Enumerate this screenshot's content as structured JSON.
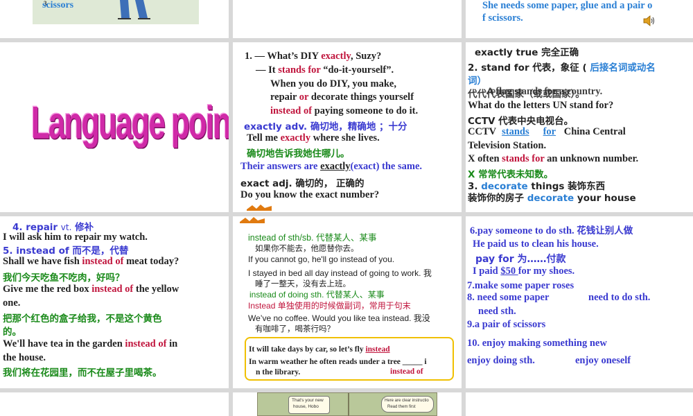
{
  "panel1": {
    "number": "3",
    "caption": "scissors"
  },
  "panel3": {
    "line1": "She needs some paper, glue and a pair o",
    "line2": "f scissors."
  },
  "panel4": {
    "title": "Language points"
  },
  "panel5": {
    "l1_a": "1. — What’s DIY ",
    "l1_b": "exactly",
    "l1_c": ", Suzy?",
    "l2_a": "— It ",
    "l2_b": "stands for",
    "l2_c": " “do-it-yourself”.",
    "l3": "When you do DIY, you make,",
    "l4_a": "repair ",
    "l4_b": "or",
    "l4_c": " decorate things yourself",
    "l5_a": "instead of",
    "l5_b": " paying someone to do it.",
    "l6": "exactly adv.  确切地，精确地  ；十分",
    "l7_a": "Tell me ",
    "l7_b": "exactly",
    "l7_c": " where she lives.",
    "l8": "确切地告诉我她住哪儿。",
    "l9_a": "Their answers are ",
    "l9_b": "exactly",
    "l9_c": "(exact) the same.",
    "l10": "exact  adj.   确切的，  正确的",
    "l11": "Do you know the exact number?"
  },
  "panel6": {
    "l1": "exactly true   完全正确",
    "l2_a": "2. stand for   代表，象征 (",
    "l2_b": " 后接名词或动名",
    "l3": "词）",
    "l4_overlap_a": "代代代表国家（或或国家）。",
    "l4_overlap_b": "A flag stands for a country.",
    "l5": "What do the letters UN stand for?",
    "l6": "CCTV 代表中央电视台。",
    "l7_a": "CCTV",
    "l7_b": "stands",
    "l7_c": "for",
    "l7_d": " China Central",
    "l8": "Television Station.",
    "l9_a": "X often ",
    "l9_b": "stands for",
    "l9_c": " an unknown number.",
    "l10": "X 常常代表未知数。",
    "l11_a": "3. ",
    "l11_b": "decorate",
    "l11_c": " things  装饰东西",
    "l12_a": "装饰你的房子  ",
    "l12_b": "decorate",
    "l12_c": " your house"
  },
  "panel7": {
    "l1_a": "4.   repair  ",
    "l1_b": "vt.",
    "l1_c": "    修补",
    "l2": "I will ask him to repair my watch.",
    "l3": "5.  instead of  而不是，代替",
    "l4_a": "Shall we have fish ",
    "l4_b": "instead of",
    "l4_c": " meat today?",
    "l5": "我们今天吃鱼不吃肉，好吗？",
    "l6_a": "Give me the red box ",
    "l6_b": "instead of",
    "l6_c": " the yellow",
    "l7": "one.",
    "l8": "把那个红色的盒子给我，不是这个黄色",
    "l9": "的。",
    "l10_a": "We'll have tea in the garden ",
    "l10_b": "instead of",
    "l10_c": " in",
    "l11": "the house.",
    "l12": "我们将在花园里，而不在屋子里喝茶。"
  },
  "panel8": {
    "l1": "instead of  sth/sb. 代替某人、某事",
    "l2": "如果你不能去，他愿替你去。",
    "l3": "If you cannot go, he'll go instead of you.",
    "l4": "I stayed in bed all day instead of going to work.  我",
    "l5": "睡了一整天，没有去上班。",
    "l6": "instead of  doing  sth. 代替某人、某事",
    "l7_a": "Instead",
    "l7_b": "  单独使用的时候做副词，常用于句末",
    "l8": "We’ve no coffee. Would you like tea instead.  我没",
    "l9": "有咖啡了，喝茶行吗？",
    "box_l1_a": "It will take days by car, so let’s fly ",
    "box_l1_b": "instead",
    "box_l2": "In warm weather he often reads under a tree _____ i",
    "box_l3": "n the library.",
    "box_answer2": "instead of"
  },
  "panel9": {
    "l1_a": "6.pay someone to do sth.    ",
    "l1_b": "花钱让别人做",
    "l2": "He paid us to clean his house.",
    "l3": "pay for   为……付款",
    "l4_a": "I paid ",
    "l4_b": "$50 ",
    "l4_c": "for my shoes.",
    "l5": "7.make some paper roses",
    "l6_a": "8. need some paper",
    "l6_b": "need to do sth.",
    "l7": "need sth.",
    "l8": "9.a pair of scissors",
    "l9": "10. enjoy making something new",
    "l10_a": "enjoy doing sth.",
    "l10_b": "enjoy oneself"
  },
  "panel11": {
    "bubble1_a": "That's your new",
    "bubble1_b": "house, Hobo",
    "bubble2_a": "Here are clear instructio",
    "bubble2_b": "Read them first"
  },
  "colors": {
    "red": "#c0143c",
    "blue": "#3a3ad0",
    "light_blue": "#2a7fd4",
    "green": "#1a8a1a",
    "title_magenta": "#d02aa8",
    "box_border": "#f0c000"
  }
}
